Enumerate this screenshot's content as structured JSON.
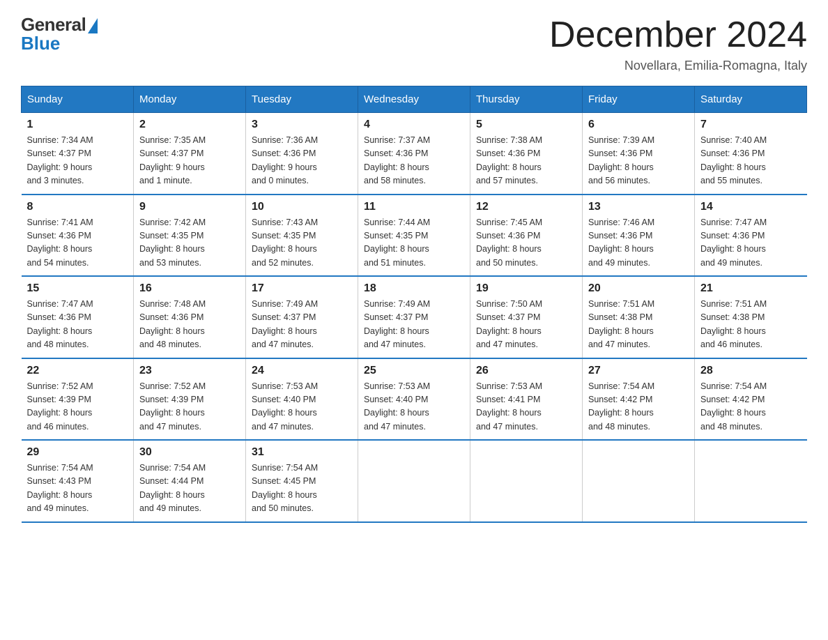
{
  "logo": {
    "general": "General",
    "blue": "Blue"
  },
  "title": "December 2024",
  "subtitle": "Novellara, Emilia-Romagna, Italy",
  "days_of_week": [
    "Sunday",
    "Monday",
    "Tuesday",
    "Wednesday",
    "Thursday",
    "Friday",
    "Saturday"
  ],
  "weeks": [
    [
      {
        "day": "1",
        "info": "Sunrise: 7:34 AM\nSunset: 4:37 PM\nDaylight: 9 hours\nand 3 minutes."
      },
      {
        "day": "2",
        "info": "Sunrise: 7:35 AM\nSunset: 4:37 PM\nDaylight: 9 hours\nand 1 minute."
      },
      {
        "day": "3",
        "info": "Sunrise: 7:36 AM\nSunset: 4:36 PM\nDaylight: 9 hours\nand 0 minutes."
      },
      {
        "day": "4",
        "info": "Sunrise: 7:37 AM\nSunset: 4:36 PM\nDaylight: 8 hours\nand 58 minutes."
      },
      {
        "day": "5",
        "info": "Sunrise: 7:38 AM\nSunset: 4:36 PM\nDaylight: 8 hours\nand 57 minutes."
      },
      {
        "day": "6",
        "info": "Sunrise: 7:39 AM\nSunset: 4:36 PM\nDaylight: 8 hours\nand 56 minutes."
      },
      {
        "day": "7",
        "info": "Sunrise: 7:40 AM\nSunset: 4:36 PM\nDaylight: 8 hours\nand 55 minutes."
      }
    ],
    [
      {
        "day": "8",
        "info": "Sunrise: 7:41 AM\nSunset: 4:36 PM\nDaylight: 8 hours\nand 54 minutes."
      },
      {
        "day": "9",
        "info": "Sunrise: 7:42 AM\nSunset: 4:35 PM\nDaylight: 8 hours\nand 53 minutes."
      },
      {
        "day": "10",
        "info": "Sunrise: 7:43 AM\nSunset: 4:35 PM\nDaylight: 8 hours\nand 52 minutes."
      },
      {
        "day": "11",
        "info": "Sunrise: 7:44 AM\nSunset: 4:35 PM\nDaylight: 8 hours\nand 51 minutes."
      },
      {
        "day": "12",
        "info": "Sunrise: 7:45 AM\nSunset: 4:36 PM\nDaylight: 8 hours\nand 50 minutes."
      },
      {
        "day": "13",
        "info": "Sunrise: 7:46 AM\nSunset: 4:36 PM\nDaylight: 8 hours\nand 49 minutes."
      },
      {
        "day": "14",
        "info": "Sunrise: 7:47 AM\nSunset: 4:36 PM\nDaylight: 8 hours\nand 49 minutes."
      }
    ],
    [
      {
        "day": "15",
        "info": "Sunrise: 7:47 AM\nSunset: 4:36 PM\nDaylight: 8 hours\nand 48 minutes."
      },
      {
        "day": "16",
        "info": "Sunrise: 7:48 AM\nSunset: 4:36 PM\nDaylight: 8 hours\nand 48 minutes."
      },
      {
        "day": "17",
        "info": "Sunrise: 7:49 AM\nSunset: 4:37 PM\nDaylight: 8 hours\nand 47 minutes."
      },
      {
        "day": "18",
        "info": "Sunrise: 7:49 AM\nSunset: 4:37 PM\nDaylight: 8 hours\nand 47 minutes."
      },
      {
        "day": "19",
        "info": "Sunrise: 7:50 AM\nSunset: 4:37 PM\nDaylight: 8 hours\nand 47 minutes."
      },
      {
        "day": "20",
        "info": "Sunrise: 7:51 AM\nSunset: 4:38 PM\nDaylight: 8 hours\nand 47 minutes."
      },
      {
        "day": "21",
        "info": "Sunrise: 7:51 AM\nSunset: 4:38 PM\nDaylight: 8 hours\nand 46 minutes."
      }
    ],
    [
      {
        "day": "22",
        "info": "Sunrise: 7:52 AM\nSunset: 4:39 PM\nDaylight: 8 hours\nand 46 minutes."
      },
      {
        "day": "23",
        "info": "Sunrise: 7:52 AM\nSunset: 4:39 PM\nDaylight: 8 hours\nand 47 minutes."
      },
      {
        "day": "24",
        "info": "Sunrise: 7:53 AM\nSunset: 4:40 PM\nDaylight: 8 hours\nand 47 minutes."
      },
      {
        "day": "25",
        "info": "Sunrise: 7:53 AM\nSunset: 4:40 PM\nDaylight: 8 hours\nand 47 minutes."
      },
      {
        "day": "26",
        "info": "Sunrise: 7:53 AM\nSunset: 4:41 PM\nDaylight: 8 hours\nand 47 minutes."
      },
      {
        "day": "27",
        "info": "Sunrise: 7:54 AM\nSunset: 4:42 PM\nDaylight: 8 hours\nand 48 minutes."
      },
      {
        "day": "28",
        "info": "Sunrise: 7:54 AM\nSunset: 4:42 PM\nDaylight: 8 hours\nand 48 minutes."
      }
    ],
    [
      {
        "day": "29",
        "info": "Sunrise: 7:54 AM\nSunset: 4:43 PM\nDaylight: 8 hours\nand 49 minutes."
      },
      {
        "day": "30",
        "info": "Sunrise: 7:54 AM\nSunset: 4:44 PM\nDaylight: 8 hours\nand 49 minutes."
      },
      {
        "day": "31",
        "info": "Sunrise: 7:54 AM\nSunset: 4:45 PM\nDaylight: 8 hours\nand 50 minutes."
      },
      null,
      null,
      null,
      null
    ]
  ]
}
